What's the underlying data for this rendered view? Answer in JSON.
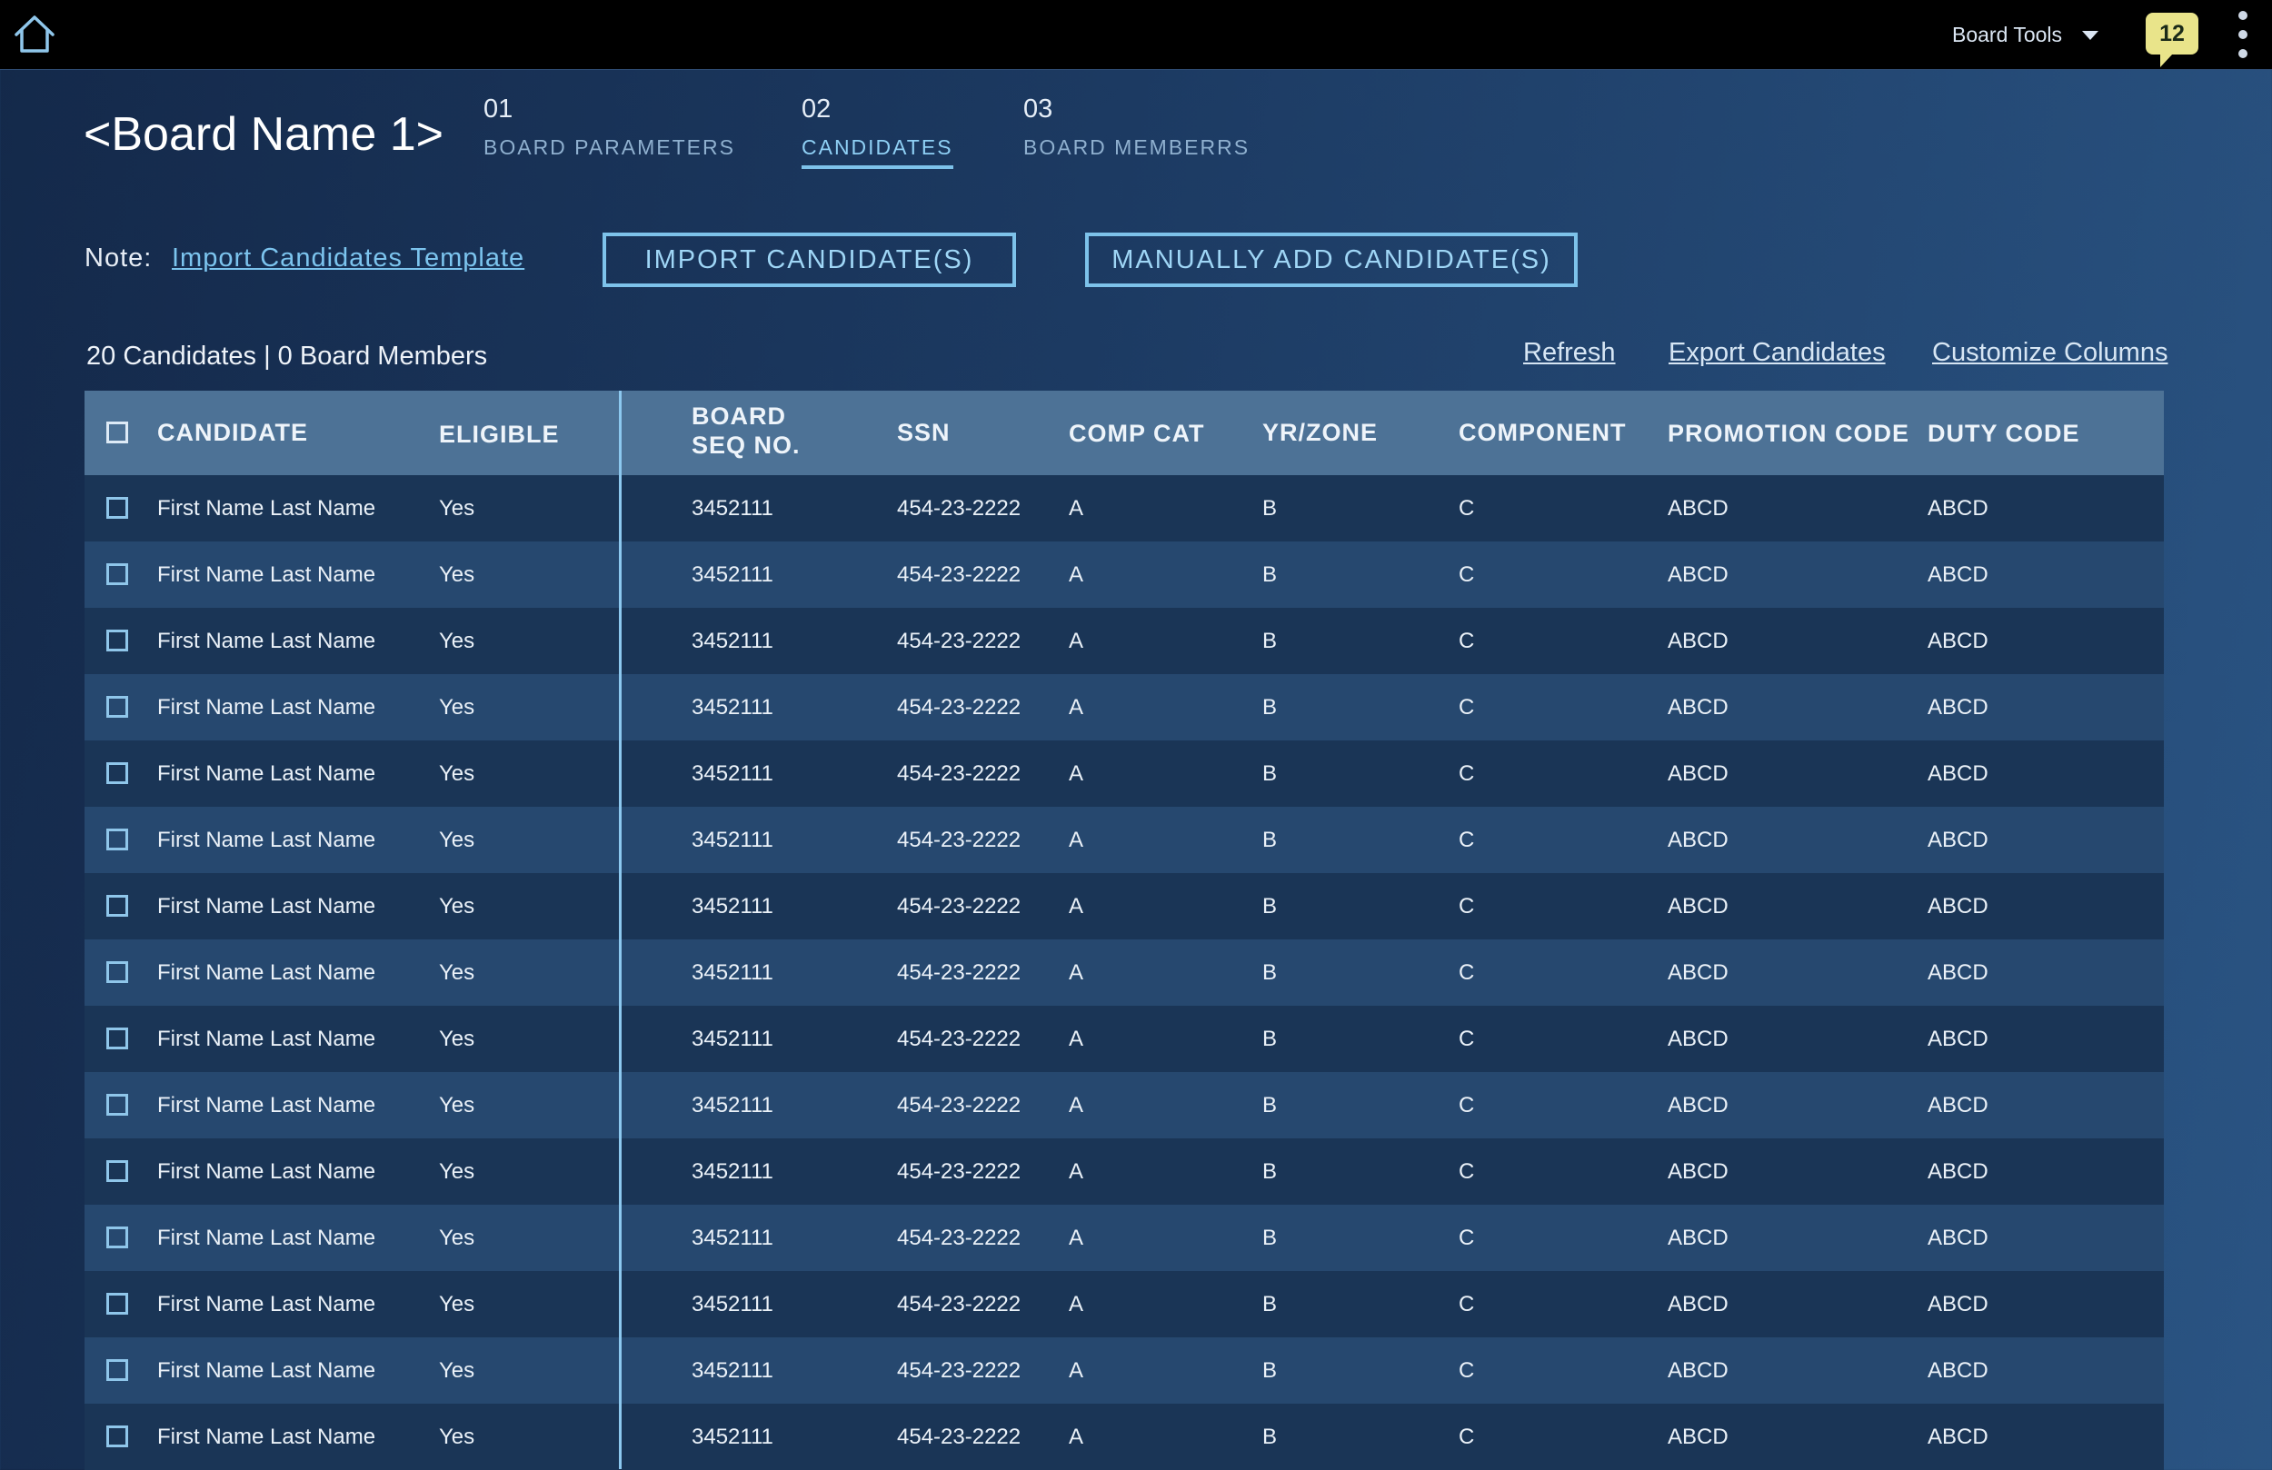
{
  "topbar": {
    "home_icon": "home-icon",
    "tools_label": "Board Tools",
    "notification_count": "12",
    "more_icon": "vertical-ellipsis-icon"
  },
  "board": {
    "title": "<Board Name 1>",
    "steps": [
      {
        "num": "01",
        "label": "BOARD PARAMETERS"
      },
      {
        "num": "02",
        "label": "CANDIDATES"
      },
      {
        "num": "03",
        "label": "BOARD MEMBERRS"
      }
    ],
    "active_step": "02"
  },
  "note": {
    "label": "Note:",
    "link": "Import Candidates Template"
  },
  "buttons": {
    "import": "IMPORT CANDIDATE(S)",
    "manual_add": "MANUALLY ADD CANDIDATE(S)"
  },
  "summary": {
    "count_text": "20 Candidates | 0 Board Members",
    "refresh": "Refresh",
    "export": "Export Candidates",
    "customize": "Customize Columns"
  },
  "table": {
    "headers": {
      "candidate": "CANDIDATE",
      "eligible": "ELIGIBLE",
      "board_seq_1": "BOARD",
      "board_seq_2": "SEQ NO.",
      "ssn": "SSN",
      "comp_cat": "COMP CAT",
      "yr_zone": "YR/ZONE",
      "component": "COMPONENT",
      "promotion_code": "PROMOTION CODE",
      "duty_code": "DUTY CODE"
    },
    "rows": [
      {
        "candidate": "First Name Last Name",
        "eligible": "Yes",
        "seq": "3452111",
        "ssn": "454-23-2222",
        "comp_cat": "A",
        "yr_zone": "B",
        "component": "C",
        "promotion_code": "ABCD",
        "duty_code": "ABCD"
      },
      {
        "candidate": "First Name Last Name",
        "eligible": "Yes",
        "seq": "3452111",
        "ssn": "454-23-2222",
        "comp_cat": "A",
        "yr_zone": "B",
        "component": "C",
        "promotion_code": "ABCD",
        "duty_code": "ABCD"
      },
      {
        "candidate": "First Name Last Name",
        "eligible": "Yes",
        "seq": "3452111",
        "ssn": "454-23-2222",
        "comp_cat": "A",
        "yr_zone": "B",
        "component": "C",
        "promotion_code": "ABCD",
        "duty_code": "ABCD"
      },
      {
        "candidate": "First Name Last Name",
        "eligible": "Yes",
        "seq": "3452111",
        "ssn": "454-23-2222",
        "comp_cat": "A",
        "yr_zone": "B",
        "component": "C",
        "promotion_code": "ABCD",
        "duty_code": "ABCD"
      },
      {
        "candidate": "First Name Last Name",
        "eligible": "Yes",
        "seq": "3452111",
        "ssn": "454-23-2222",
        "comp_cat": "A",
        "yr_zone": "B",
        "component": "C",
        "promotion_code": "ABCD",
        "duty_code": "ABCD"
      },
      {
        "candidate": "First Name Last Name",
        "eligible": "Yes",
        "seq": "3452111",
        "ssn": "454-23-2222",
        "comp_cat": "A",
        "yr_zone": "B",
        "component": "C",
        "promotion_code": "ABCD",
        "duty_code": "ABCD"
      },
      {
        "candidate": "First Name Last Name",
        "eligible": "Yes",
        "seq": "3452111",
        "ssn": "454-23-2222",
        "comp_cat": "A",
        "yr_zone": "B",
        "component": "C",
        "promotion_code": "ABCD",
        "duty_code": "ABCD"
      },
      {
        "candidate": "First Name Last Name",
        "eligible": "Yes",
        "seq": "3452111",
        "ssn": "454-23-2222",
        "comp_cat": "A",
        "yr_zone": "B",
        "component": "C",
        "promotion_code": "ABCD",
        "duty_code": "ABCD"
      },
      {
        "candidate": "First Name Last Name",
        "eligible": "Yes",
        "seq": "3452111",
        "ssn": "454-23-2222",
        "comp_cat": "A",
        "yr_zone": "B",
        "component": "C",
        "promotion_code": "ABCD",
        "duty_code": "ABCD"
      },
      {
        "candidate": "First Name Last Name",
        "eligible": "Yes",
        "seq": "3452111",
        "ssn": "454-23-2222",
        "comp_cat": "A",
        "yr_zone": "B",
        "component": "C",
        "promotion_code": "ABCD",
        "duty_code": "ABCD"
      },
      {
        "candidate": "First Name Last Name",
        "eligible": "Yes",
        "seq": "3452111",
        "ssn": "454-23-2222",
        "comp_cat": "A",
        "yr_zone": "B",
        "component": "C",
        "promotion_code": "ABCD",
        "duty_code": "ABCD"
      },
      {
        "candidate": "First Name Last Name",
        "eligible": "Yes",
        "seq": "3452111",
        "ssn": "454-23-2222",
        "comp_cat": "A",
        "yr_zone": "B",
        "component": "C",
        "promotion_code": "ABCD",
        "duty_code": "ABCD"
      },
      {
        "candidate": "First Name Last Name",
        "eligible": "Yes",
        "seq": "3452111",
        "ssn": "454-23-2222",
        "comp_cat": "A",
        "yr_zone": "B",
        "component": "C",
        "promotion_code": "ABCD",
        "duty_code": "ABCD"
      },
      {
        "candidate": "First Name Last Name",
        "eligible": "Yes",
        "seq": "3452111",
        "ssn": "454-23-2222",
        "comp_cat": "A",
        "yr_zone": "B",
        "component": "C",
        "promotion_code": "ABCD",
        "duty_code": "ABCD"
      },
      {
        "candidate": "First Name Last Name",
        "eligible": "Yes",
        "seq": "3452111",
        "ssn": "454-23-2222",
        "comp_cat": "A",
        "yr_zone": "B",
        "component": "C",
        "promotion_code": "ABCD",
        "duty_code": "ABCD"
      }
    ]
  },
  "colors": {
    "accent": "#7dc2ea",
    "header_row": "#4d7296",
    "row_dark": "#1a3556",
    "row_light": "#26486f",
    "badge": "#e9e48a"
  }
}
